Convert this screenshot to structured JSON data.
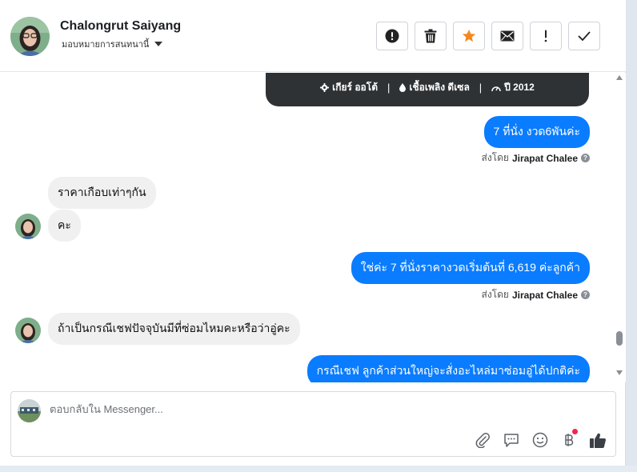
{
  "contact": {
    "name": "Chalongrut Saiyang",
    "assign_label": "มอบหมายการสนทนานี้"
  },
  "toolbar": {
    "buttons": [
      {
        "name": "report-button",
        "icon": "alert-circle-icon"
      },
      {
        "name": "delete-button",
        "icon": "trash-icon"
      },
      {
        "name": "star-button",
        "icon": "star-icon",
        "color": "#f5871f"
      },
      {
        "name": "email-button",
        "icon": "envelope-icon"
      },
      {
        "name": "important-button",
        "icon": "exclamation-icon"
      },
      {
        "name": "done-button",
        "icon": "check-icon"
      }
    ]
  },
  "card": {
    "gear": "เกียร์ ออโต้",
    "fuel": "เชื้อเพลิง ดีเซล",
    "year": "ปี 2012"
  },
  "messages": [
    {
      "dir": "out",
      "text": "7 ที่นั่ง งวด6พันค่ะ"
    },
    {
      "dir": "meta",
      "prefix": "ส่งโดย",
      "sender": "Jirapat Chalee"
    },
    {
      "dir": "in",
      "text": "ราคาเกือบเท่าๆกัน"
    },
    {
      "dir": "in",
      "text": "คะ"
    },
    {
      "dir": "out",
      "text": "ใช่ค่ะ 7 ที่นั่งราคางวดเริ่มต้นที่ 6,619 ค่ะลูกค้า"
    },
    {
      "dir": "meta",
      "prefix": "ส่งโดย",
      "sender": "Jirapat Chalee"
    },
    {
      "dir": "in",
      "text": "ถ้าเป็นกรณีเชฟปัจจุบันมีที่ซ่อมไหมคะหรือว่าอู่คะ"
    },
    {
      "dir": "out",
      "text": "กรณีเชฟ ลูกค้าส่วนใหญ่จะสั่งอะไหล่มาซ่อมอู่ได้ปกติค่ะ"
    }
  ],
  "composer": {
    "placeholder": "ตอบกลับใน Messenger...",
    "value": "",
    "icons": [
      "paperclip-icon",
      "chat-bubble-icon",
      "smiley-icon",
      "baht-icon",
      "thumbs-up-icon"
    ]
  },
  "colors": {
    "outgoing": "#0a7cff",
    "incoming": "#f0f0f0",
    "card": "#2f3235",
    "notify_dot": "#f02849"
  }
}
